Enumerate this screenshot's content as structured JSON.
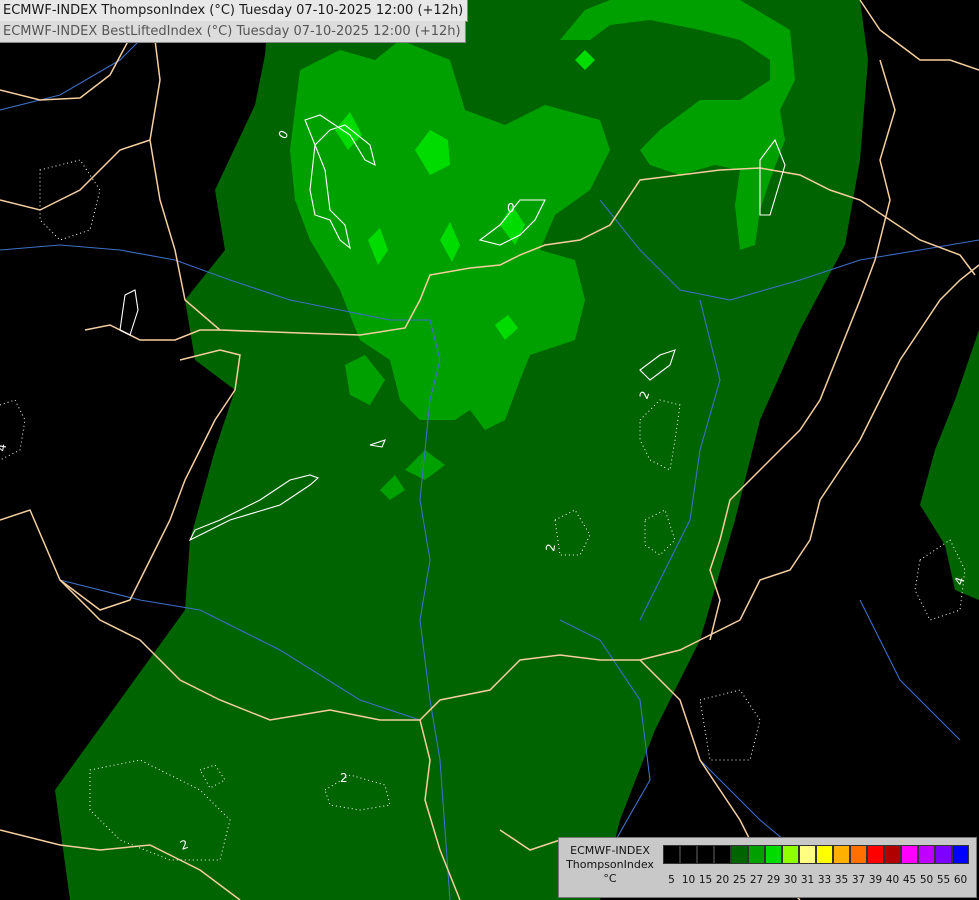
{
  "header": {
    "line1": "ECMWF-INDEX ThompsonIndex (°C) Tuesday 07-10-2025 12:00 (+12h)",
    "line2": "ECMWF-INDEX BestLiftedIndex (°C) Tuesday 07-10-2025 12:00 (+12h)"
  },
  "legend": {
    "line1": "ECMWF-INDEX",
    "line2": "ThompsonIndex",
    "unit": "°C",
    "swatches": [
      {
        "color": "#000000",
        "label": "5"
      },
      {
        "color": "#000000",
        "label": "10"
      },
      {
        "color": "#000000",
        "label": "15"
      },
      {
        "color": "#000000",
        "label": "20"
      },
      {
        "color": "#006400",
        "label": "25"
      },
      {
        "color": "#00a000",
        "label": "27"
      },
      {
        "color": "#00dc00",
        "label": "29"
      },
      {
        "color": "#90ff00",
        "label": "30"
      },
      {
        "color": "#ffff80",
        "label": "31"
      },
      {
        "color": "#ffff00",
        "label": "33"
      },
      {
        "color": "#ffb000",
        "label": "35"
      },
      {
        "color": "#ff7000",
        "label": "37"
      },
      {
        "color": "#ff0000",
        "label": "39"
      },
      {
        "color": "#b00000",
        "label": "40"
      },
      {
        "color": "#ff00ff",
        "label": "45"
      },
      {
        "color": "#c000ff",
        "label": "50"
      },
      {
        "color": "#8000ff",
        "label": "55"
      },
      {
        "color": "#0000ff",
        "label": "60"
      }
    ]
  },
  "contour_labels": [
    "0",
    "0",
    "2",
    "2",
    "2",
    "2",
    "4",
    "4"
  ],
  "colors": {
    "background": "#000000",
    "level_25": "#006400",
    "level_27": "#00a000",
    "level_29": "#00dc00",
    "border": "#f5cfa0",
    "river": "#3e6fc4"
  }
}
